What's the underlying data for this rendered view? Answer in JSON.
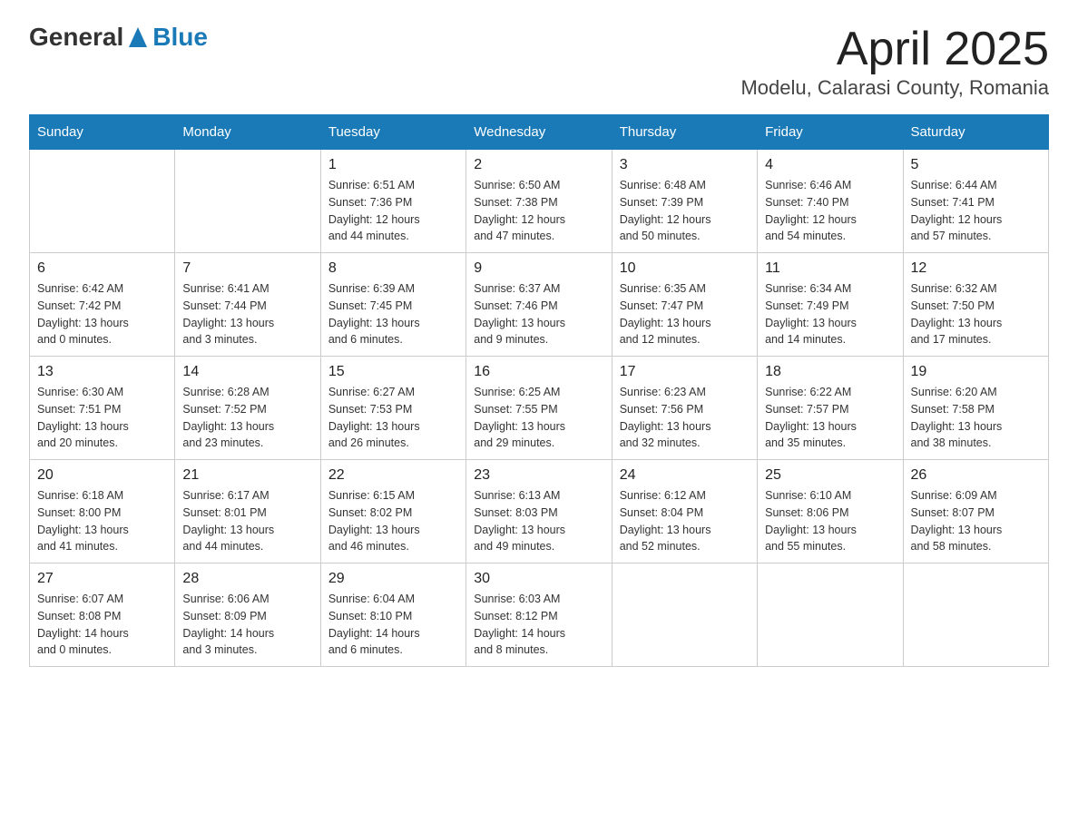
{
  "header": {
    "logo": {
      "general": "General",
      "blue": "Blue"
    },
    "title": "April 2025",
    "subtitle": "Modelu, Calarasi County, Romania"
  },
  "calendar": {
    "days_of_week": [
      "Sunday",
      "Monday",
      "Tuesday",
      "Wednesday",
      "Thursday",
      "Friday",
      "Saturday"
    ],
    "weeks": [
      [
        {
          "day": "",
          "info": ""
        },
        {
          "day": "",
          "info": ""
        },
        {
          "day": "1",
          "info": "Sunrise: 6:51 AM\nSunset: 7:36 PM\nDaylight: 12 hours\nand 44 minutes."
        },
        {
          "day": "2",
          "info": "Sunrise: 6:50 AM\nSunset: 7:38 PM\nDaylight: 12 hours\nand 47 minutes."
        },
        {
          "day": "3",
          "info": "Sunrise: 6:48 AM\nSunset: 7:39 PM\nDaylight: 12 hours\nand 50 minutes."
        },
        {
          "day": "4",
          "info": "Sunrise: 6:46 AM\nSunset: 7:40 PM\nDaylight: 12 hours\nand 54 minutes."
        },
        {
          "day": "5",
          "info": "Sunrise: 6:44 AM\nSunset: 7:41 PM\nDaylight: 12 hours\nand 57 minutes."
        }
      ],
      [
        {
          "day": "6",
          "info": "Sunrise: 6:42 AM\nSunset: 7:42 PM\nDaylight: 13 hours\nand 0 minutes."
        },
        {
          "day": "7",
          "info": "Sunrise: 6:41 AM\nSunset: 7:44 PM\nDaylight: 13 hours\nand 3 minutes."
        },
        {
          "day": "8",
          "info": "Sunrise: 6:39 AM\nSunset: 7:45 PM\nDaylight: 13 hours\nand 6 minutes."
        },
        {
          "day": "9",
          "info": "Sunrise: 6:37 AM\nSunset: 7:46 PM\nDaylight: 13 hours\nand 9 minutes."
        },
        {
          "day": "10",
          "info": "Sunrise: 6:35 AM\nSunset: 7:47 PM\nDaylight: 13 hours\nand 12 minutes."
        },
        {
          "day": "11",
          "info": "Sunrise: 6:34 AM\nSunset: 7:49 PM\nDaylight: 13 hours\nand 14 minutes."
        },
        {
          "day": "12",
          "info": "Sunrise: 6:32 AM\nSunset: 7:50 PM\nDaylight: 13 hours\nand 17 minutes."
        }
      ],
      [
        {
          "day": "13",
          "info": "Sunrise: 6:30 AM\nSunset: 7:51 PM\nDaylight: 13 hours\nand 20 minutes."
        },
        {
          "day": "14",
          "info": "Sunrise: 6:28 AM\nSunset: 7:52 PM\nDaylight: 13 hours\nand 23 minutes."
        },
        {
          "day": "15",
          "info": "Sunrise: 6:27 AM\nSunset: 7:53 PM\nDaylight: 13 hours\nand 26 minutes."
        },
        {
          "day": "16",
          "info": "Sunrise: 6:25 AM\nSunset: 7:55 PM\nDaylight: 13 hours\nand 29 minutes."
        },
        {
          "day": "17",
          "info": "Sunrise: 6:23 AM\nSunset: 7:56 PM\nDaylight: 13 hours\nand 32 minutes."
        },
        {
          "day": "18",
          "info": "Sunrise: 6:22 AM\nSunset: 7:57 PM\nDaylight: 13 hours\nand 35 minutes."
        },
        {
          "day": "19",
          "info": "Sunrise: 6:20 AM\nSunset: 7:58 PM\nDaylight: 13 hours\nand 38 minutes."
        }
      ],
      [
        {
          "day": "20",
          "info": "Sunrise: 6:18 AM\nSunset: 8:00 PM\nDaylight: 13 hours\nand 41 minutes."
        },
        {
          "day": "21",
          "info": "Sunrise: 6:17 AM\nSunset: 8:01 PM\nDaylight: 13 hours\nand 44 minutes."
        },
        {
          "day": "22",
          "info": "Sunrise: 6:15 AM\nSunset: 8:02 PM\nDaylight: 13 hours\nand 46 minutes."
        },
        {
          "day": "23",
          "info": "Sunrise: 6:13 AM\nSunset: 8:03 PM\nDaylight: 13 hours\nand 49 minutes."
        },
        {
          "day": "24",
          "info": "Sunrise: 6:12 AM\nSunset: 8:04 PM\nDaylight: 13 hours\nand 52 minutes."
        },
        {
          "day": "25",
          "info": "Sunrise: 6:10 AM\nSunset: 8:06 PM\nDaylight: 13 hours\nand 55 minutes."
        },
        {
          "day": "26",
          "info": "Sunrise: 6:09 AM\nSunset: 8:07 PM\nDaylight: 13 hours\nand 58 minutes."
        }
      ],
      [
        {
          "day": "27",
          "info": "Sunrise: 6:07 AM\nSunset: 8:08 PM\nDaylight: 14 hours\nand 0 minutes."
        },
        {
          "day": "28",
          "info": "Sunrise: 6:06 AM\nSunset: 8:09 PM\nDaylight: 14 hours\nand 3 minutes."
        },
        {
          "day": "29",
          "info": "Sunrise: 6:04 AM\nSunset: 8:10 PM\nDaylight: 14 hours\nand 6 minutes."
        },
        {
          "day": "30",
          "info": "Sunrise: 6:03 AM\nSunset: 8:12 PM\nDaylight: 14 hours\nand 8 minutes."
        },
        {
          "day": "",
          "info": ""
        },
        {
          "day": "",
          "info": ""
        },
        {
          "day": "",
          "info": ""
        }
      ]
    ]
  }
}
